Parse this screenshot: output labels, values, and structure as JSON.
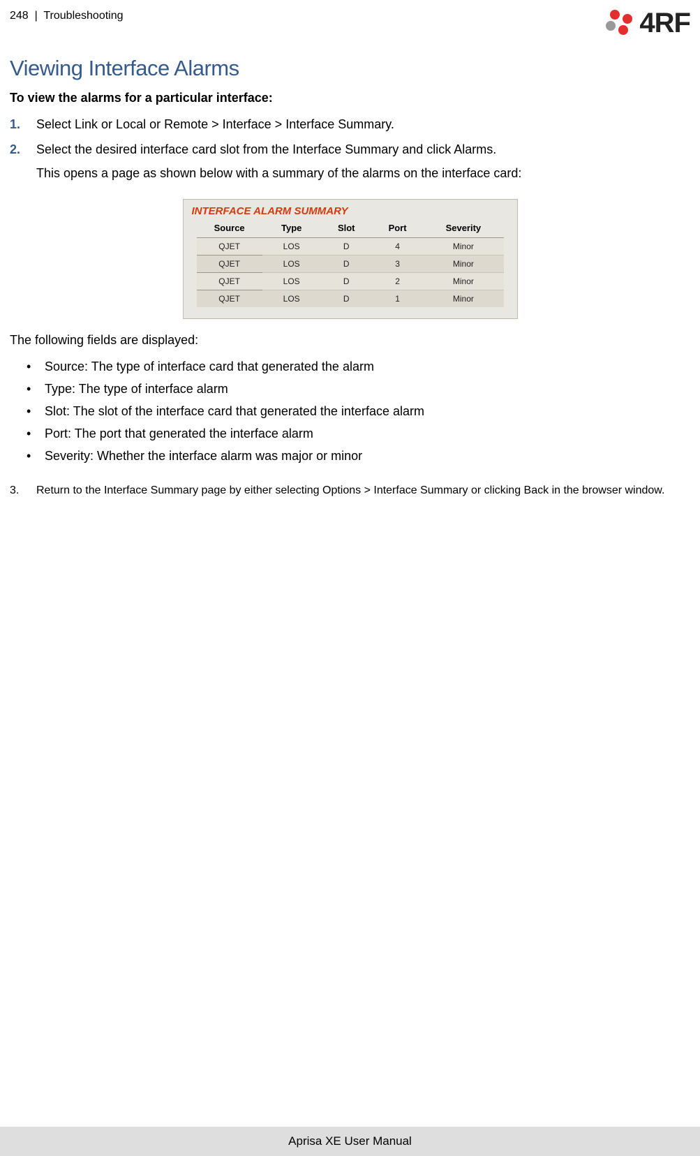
{
  "header": {
    "page_number": "248",
    "divider": "|",
    "section": "Troubleshooting",
    "brand": "4RF"
  },
  "title": "Viewing Interface Alarms",
  "intro_bold": "To view the alarms for a particular interface:",
  "steps": {
    "s1": {
      "num": "1.",
      "text": "Select Link or Local or Remote > Interface > Interface Summary."
    },
    "s2": {
      "num": "2.",
      "text": "Select the desired interface card slot from the Interface Summary and click Alarms.",
      "sub": "This opens a page as shown below with a summary of the alarms on the interface card:"
    },
    "s3": {
      "num": "3.",
      "text": "Return to the Interface Summary page by either selecting Options > Interface Summary or clicking Back in the browser window."
    }
  },
  "alarm_panel": {
    "title": "INTERFACE ALARM SUMMARY",
    "columns": {
      "source": "Source",
      "type": "Type",
      "slot": "Slot",
      "port": "Port",
      "severity": "Severity"
    },
    "rows": [
      {
        "source": "QJET",
        "type": "LOS",
        "slot": "D",
        "port": "4",
        "severity": "Minor"
      },
      {
        "source": "QJET",
        "type": "LOS",
        "slot": "D",
        "port": "3",
        "severity": "Minor"
      },
      {
        "source": "QJET",
        "type": "LOS",
        "slot": "D",
        "port": "2",
        "severity": "Minor"
      },
      {
        "source": "QJET",
        "type": "LOS",
        "slot": "D",
        "port": "1",
        "severity": "Minor"
      }
    ]
  },
  "fields_intro": "The following fields are displayed:",
  "field_bullets": {
    "b0": "Source: The type of interface card that generated the alarm",
    "b1": "Type: The type of interface alarm",
    "b2": "Slot: The slot of the interface card that generated the interface alarm",
    "b3": "Port: The port that generated the interface alarm",
    "b4": "Severity: Whether the interface alarm was major or minor"
  },
  "footer": "Aprisa XE User Manual",
  "chart_data": {
    "type": "table",
    "title": "INTERFACE ALARM SUMMARY",
    "columns": [
      "Source",
      "Type",
      "Slot",
      "Port",
      "Severity"
    ],
    "rows": [
      [
        "QJET",
        "LOS",
        "D",
        4,
        "Minor"
      ],
      [
        "QJET",
        "LOS",
        "D",
        3,
        "Minor"
      ],
      [
        "QJET",
        "LOS",
        "D",
        2,
        "Minor"
      ],
      [
        "QJET",
        "LOS",
        "D",
        1,
        "Minor"
      ]
    ]
  }
}
